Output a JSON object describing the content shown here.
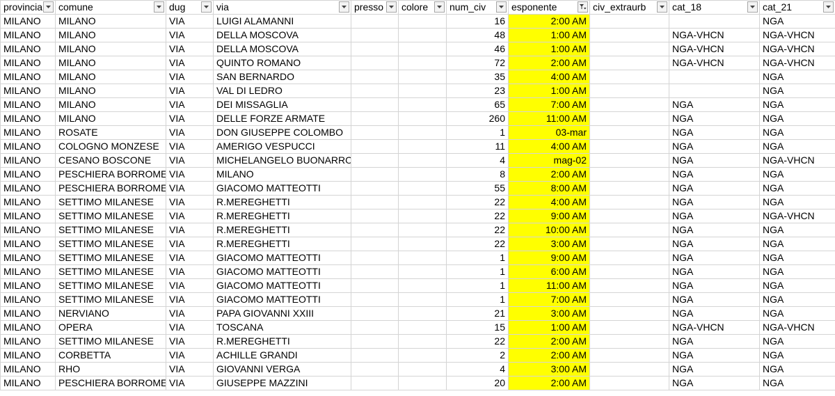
{
  "headers": [
    {
      "key": "provincia",
      "label": "provincia",
      "filtered": false
    },
    {
      "key": "comune",
      "label": "comune",
      "filtered": false
    },
    {
      "key": "dug",
      "label": "dug",
      "filtered": false
    },
    {
      "key": "via",
      "label": "via",
      "filtered": false
    },
    {
      "key": "presso",
      "label": "presso",
      "filtered": false
    },
    {
      "key": "colore",
      "label": "colore",
      "filtered": false
    },
    {
      "key": "num_civ",
      "label": "num_civ",
      "filtered": false
    },
    {
      "key": "esponente",
      "label": "esponente",
      "filtered": true
    },
    {
      "key": "civ_extraurb",
      "label": "civ_extraurb",
      "filtered": false
    },
    {
      "key": "cat_18",
      "label": "cat_18",
      "filtered": false
    },
    {
      "key": "cat_21",
      "label": "cat_21",
      "filtered": false
    }
  ],
  "highlight_color": "#ffff00",
  "rows": [
    [
      "MILANO",
      "MILANO",
      "VIA",
      "LUIGI ALAMANNI",
      "",
      "",
      "16",
      "2:00 AM",
      "",
      "",
      "NGA"
    ],
    [
      "MILANO",
      "MILANO",
      "VIA",
      "DELLA MOSCOVA",
      "",
      "",
      "48",
      "1:00 AM",
      "",
      "NGA-VHCN",
      "NGA-VHCN"
    ],
    [
      "MILANO",
      "MILANO",
      "VIA",
      "DELLA MOSCOVA",
      "",
      "",
      "46",
      "1:00 AM",
      "",
      "NGA-VHCN",
      "NGA-VHCN"
    ],
    [
      "MILANO",
      "MILANO",
      "VIA",
      "QUINTO ROMANO",
      "",
      "",
      "72",
      "2:00 AM",
      "",
      "NGA-VHCN",
      "NGA-VHCN"
    ],
    [
      "MILANO",
      "MILANO",
      "VIA",
      "SAN BERNARDO",
      "",
      "",
      "35",
      "4:00 AM",
      "",
      "",
      "NGA"
    ],
    [
      "MILANO",
      "MILANO",
      "VIA",
      "VAL DI LEDRO",
      "",
      "",
      "23",
      "1:00 AM",
      "",
      "",
      "NGA"
    ],
    [
      "MILANO",
      "MILANO",
      "VIA",
      "DEI MISSAGLIA",
      "",
      "",
      "65",
      "7:00 AM",
      "",
      "NGA",
      "NGA"
    ],
    [
      "MILANO",
      "MILANO",
      "VIA",
      "DELLE FORZE ARMATE",
      "",
      "",
      "260",
      "11:00 AM",
      "",
      "NGA",
      "NGA"
    ],
    [
      "MILANO",
      "ROSATE",
      "VIA",
      "DON GIUSEPPE COLOMBO",
      "",
      "",
      "1",
      "03-mar",
      "",
      "NGA",
      "NGA"
    ],
    [
      "MILANO",
      "COLOGNO MONZESE",
      "VIA",
      "AMERIGO VESPUCCI",
      "",
      "",
      "11",
      "4:00 AM",
      "",
      "NGA",
      "NGA"
    ],
    [
      "MILANO",
      "CESANO BOSCONE",
      "VIA",
      "MICHELANGELO BUONARROTI",
      "",
      "",
      "4",
      "mag-02",
      "",
      "NGA",
      "NGA-VHCN"
    ],
    [
      "MILANO",
      "PESCHIERA BORROMEO",
      "VIA",
      "MILANO",
      "",
      "",
      "8",
      "2:00 AM",
      "",
      "NGA",
      "NGA"
    ],
    [
      "MILANO",
      "PESCHIERA BORROMEO",
      "VIA",
      "GIACOMO MATTEOTTI",
      "",
      "",
      "55",
      "8:00 AM",
      "",
      "NGA",
      "NGA"
    ],
    [
      "MILANO",
      "SETTIMO MILANESE",
      "VIA",
      "R.MEREGHETTI",
      "",
      "",
      "22",
      "4:00 AM",
      "",
      "NGA",
      "NGA"
    ],
    [
      "MILANO",
      "SETTIMO MILANESE",
      "VIA",
      "R.MEREGHETTI",
      "",
      "",
      "22",
      "9:00 AM",
      "",
      "NGA",
      "NGA-VHCN"
    ],
    [
      "MILANO",
      "SETTIMO MILANESE",
      "VIA",
      "R.MEREGHETTI",
      "",
      "",
      "22",
      "10:00 AM",
      "",
      "NGA",
      "NGA"
    ],
    [
      "MILANO",
      "SETTIMO MILANESE",
      "VIA",
      "R.MEREGHETTI",
      "",
      "",
      "22",
      "3:00 AM",
      "",
      "NGA",
      "NGA"
    ],
    [
      "MILANO",
      "SETTIMO MILANESE",
      "VIA",
      "GIACOMO MATTEOTTI",
      "",
      "",
      "1",
      "9:00 AM",
      "",
      "NGA",
      "NGA"
    ],
    [
      "MILANO",
      "SETTIMO MILANESE",
      "VIA",
      "GIACOMO MATTEOTTI",
      "",
      "",
      "1",
      "6:00 AM",
      "",
      "NGA",
      "NGA"
    ],
    [
      "MILANO",
      "SETTIMO MILANESE",
      "VIA",
      "GIACOMO MATTEOTTI",
      "",
      "",
      "1",
      "11:00 AM",
      "",
      "NGA",
      "NGA"
    ],
    [
      "MILANO",
      "SETTIMO MILANESE",
      "VIA",
      "GIACOMO MATTEOTTI",
      "",
      "",
      "1",
      "7:00 AM",
      "",
      "NGA",
      "NGA"
    ],
    [
      "MILANO",
      "NERVIANO",
      "VIA",
      "PAPA GIOVANNI XXIII",
      "",
      "",
      "21",
      "3:00 AM",
      "",
      "NGA",
      "NGA"
    ],
    [
      "MILANO",
      "OPERA",
      "VIA",
      "TOSCANA",
      "",
      "",
      "15",
      "1:00 AM",
      "",
      "NGA-VHCN",
      "NGA-VHCN"
    ],
    [
      "MILANO",
      "SETTIMO MILANESE",
      "VIA",
      "R.MEREGHETTI",
      "",
      "",
      "22",
      "2:00 AM",
      "",
      "NGA",
      "NGA"
    ],
    [
      "MILANO",
      "CORBETTA",
      "VIA",
      "ACHILLE GRANDI",
      "",
      "",
      "2",
      "2:00 AM",
      "",
      "NGA",
      "NGA"
    ],
    [
      "MILANO",
      "RHO",
      "VIA",
      "GIOVANNI VERGA",
      "",
      "",
      "4",
      "3:00 AM",
      "",
      "NGA",
      "NGA"
    ],
    [
      "MILANO",
      "PESCHIERA BORROMEO",
      "VIA",
      "GIUSEPPE MAZZINI",
      "",
      "",
      "20",
      "2:00 AM",
      "",
      "NGA",
      "NGA"
    ]
  ]
}
